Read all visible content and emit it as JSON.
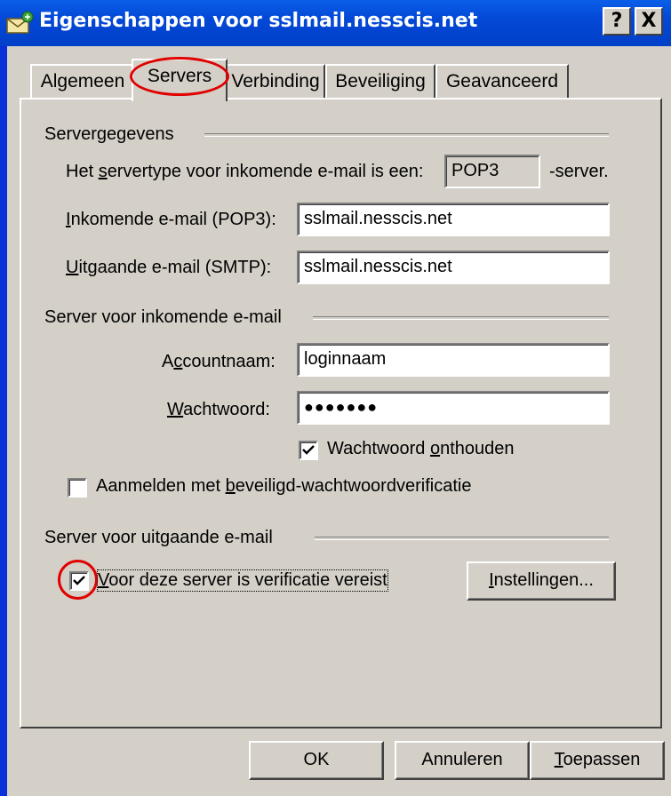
{
  "window": {
    "title": "Eigenschappen voor sslmail.nesscis.net",
    "help_label": "?",
    "close_label": "X"
  },
  "tabs": [
    {
      "label": "Algemeen"
    },
    {
      "label": "Servers"
    },
    {
      "label": "Verbinding"
    },
    {
      "label": "Beveiliging"
    },
    {
      "label": "Geavanceerd"
    }
  ],
  "servergegevens": {
    "group_label": "Servergegevens",
    "type_prefix": "Het ",
    "type_accel": "s",
    "type_rest": "ervertype voor inkomende e-mail is een:",
    "type_value": "POP3",
    "type_suffix": "-server.",
    "incoming_accel": "I",
    "incoming_rest": "nkomende e-mail (POP3):",
    "incoming_value": "sslmail.nesscis.net",
    "outgoing_accel": "U",
    "outgoing_rest": "itgaande e-mail (SMTP):",
    "outgoing_value": "sslmail.nesscis.net"
  },
  "incoming_server": {
    "group_label": "Server voor inkomende e-mail",
    "account_pre": "A",
    "account_accel": "c",
    "account_rest": "countnaam:",
    "account_value": "loginnaam",
    "password_accel": "W",
    "password_rest": "achtwoord:",
    "password_value": "●●●●●●●",
    "remember_pre": "Wachtwoord ",
    "remember_accel": "o",
    "remember_rest": "nthouden",
    "remember_checked": true,
    "spa_pre": "Aanmelden met ",
    "spa_accel": "b",
    "spa_rest": "eveiligd-wachtwoordverificatie",
    "spa_checked": false
  },
  "outgoing_server": {
    "group_label": "Server voor uitgaande e-mail",
    "auth_accel": "V",
    "auth_rest": "oor deze server is verificatie vereist",
    "auth_checked": true,
    "settings_accel": "I",
    "settings_rest": "nstellingen..."
  },
  "buttons": {
    "ok": "OK",
    "cancel": "Annuleren",
    "apply_accel": "T",
    "apply_rest": "oepassen"
  },
  "colors": {
    "titlebar": "#0348d6",
    "face": "#d4d0c8",
    "highlight_ring": "#e00000"
  }
}
